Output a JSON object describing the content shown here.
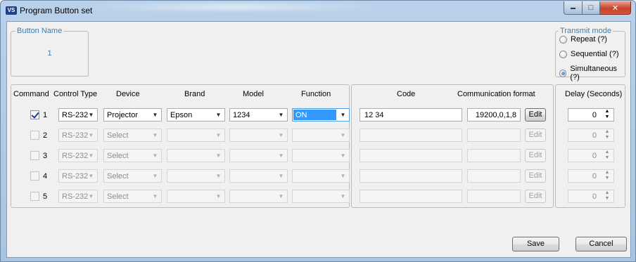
{
  "window": {
    "icon_text": "VS",
    "title": "Program Button set",
    "minimize_glyph": "▬",
    "maximize_glyph": "□",
    "close_glyph": "✕"
  },
  "button_name": {
    "legend": "Button Name",
    "value": "1"
  },
  "transmit_mode": {
    "legend": "Transmit mode",
    "options": [
      {
        "label": "Repeat (?)",
        "checked": false
      },
      {
        "label": "Sequential (?)",
        "checked": false
      },
      {
        "label": "Simultaneous (?)",
        "checked": true
      }
    ]
  },
  "headers": {
    "command": "Command",
    "control_type": "Control Type",
    "device": "Device",
    "brand": "Brand",
    "model": "Model",
    "function": "Function",
    "code": "Code",
    "communication_format": "Communication format",
    "delay": "Delay (Seconds)"
  },
  "rows": [
    {
      "num": "1",
      "checked": true,
      "enabled": true,
      "control_type": "RS-232",
      "device": "Projector",
      "brand": "Epson",
      "model": "1234",
      "function": "ON",
      "code": "12 34",
      "comm_format": "19200,0,1,8",
      "edit": "Edit",
      "delay": "0"
    },
    {
      "num": "2",
      "checked": false,
      "enabled": false,
      "control_type": "RS-232",
      "device": "Select",
      "brand": "",
      "model": "",
      "function": "",
      "code": "",
      "comm_format": "",
      "edit": "Edit",
      "delay": "0"
    },
    {
      "num": "3",
      "checked": false,
      "enabled": false,
      "control_type": "RS-232",
      "device": "Select",
      "brand": "",
      "model": "",
      "function": "",
      "code": "",
      "comm_format": "",
      "edit": "Edit",
      "delay": "0"
    },
    {
      "num": "4",
      "checked": false,
      "enabled": false,
      "control_type": "RS-232",
      "device": "Select",
      "brand": "",
      "model": "",
      "function": "",
      "code": "",
      "comm_format": "",
      "edit": "Edit",
      "delay": "0"
    },
    {
      "num": "5",
      "checked": false,
      "enabled": false,
      "control_type": "RS-232",
      "device": "Select",
      "brand": "",
      "model": "",
      "function": "",
      "code": "",
      "comm_format": "",
      "edit": "Edit",
      "delay": "0"
    }
  ],
  "footer": {
    "save_label": "Save",
    "cancel_label": "Cancel"
  }
}
